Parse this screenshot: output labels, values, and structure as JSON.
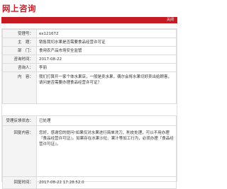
{
  "page_title": "网上咨询",
  "close_label": "关闭",
  "fields": {
    "id": {
      "label": "受理号：",
      "value": "ex121672"
    },
    "subject": {
      "label": "主　题：",
      "value": "销售我切水果是否需要食品经营许可证"
    },
    "department": {
      "label": "部　门：",
      "value": "食用农产品市场安全监管"
    },
    "time": {
      "label": "咨询时间：",
      "value": "2017-08-22"
    },
    "asker": {
      "label": "咨询人：",
      "value": "李丽"
    },
    "content": {
      "label": "内　容：",
      "value": "我们打算开一家个体水果店，一般是卖水果，偶尔会将水果切好卖出给顾客，请问是否需要办理食品经营许可证？"
    }
  },
  "reply": {
    "status_label": "受理反馈状态：",
    "status_value": "已处理",
    "content_label": "回复内容：",
    "content_value": "您好，感谢您的提问!如果仅对水果进行简单洗刀、削皮处理，可以不用办理『食品经营许可证』。如果存在水果沙拉、果汁等加工行为，必须办理『食品经营许可证』。",
    "time_label": "回复时间：",
    "time_value": "2017-08-22 17:28:52.0"
  }
}
